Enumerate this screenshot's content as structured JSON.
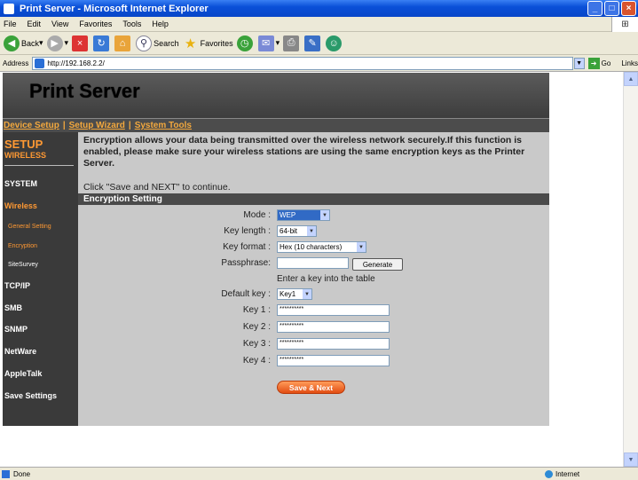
{
  "window": {
    "title": "Print Server - Microsoft Internet Explorer"
  },
  "menu": [
    "File",
    "Edit",
    "View",
    "Favorites",
    "Tools",
    "Help"
  ],
  "toolbar": {
    "back": "Back",
    "search": "Search",
    "favorites": "Favorites"
  },
  "address": {
    "label": "Address",
    "url": "http://192.168.2.2/",
    "go": "Go",
    "links": "Links"
  },
  "page": {
    "banner_title": "Print Server",
    "nav": [
      "Device Setup",
      "Setup Wizard",
      "System Tools"
    ],
    "sidebar": {
      "setup": "SETUP",
      "wireless_sub": "WIRELESS",
      "system": "SYSTEM",
      "wireless": "Wireless",
      "general_setting": "General Setting",
      "encryption": "Encryption",
      "site_survey": "SiteSurvey",
      "tcpip": "TCP/IP",
      "smb": "SMB",
      "snmp": "SNMP",
      "netware": "NetWare",
      "appletalk": "AppleTalk",
      "save_settings": "Save Settings"
    },
    "description": "Encryption allows your data being transmitted over the wireless network securely.If this function is enabled, please make sure your wireless stations are using the same encryption keys as the Printer Server.",
    "instruction": "Click \"Save and NEXT\" to continue.",
    "section_title": "Encryption Setting",
    "form": {
      "mode_label": "Mode :",
      "mode_value": "WEP",
      "keylen_label": "Key length :",
      "keylen_value": "64-bit",
      "keyfmt_label": "Key format :",
      "keyfmt_value": "Hex (10 characters)",
      "pass_label": "Passphrase:",
      "pass_value": "",
      "generate": "Generate",
      "hint": "Enter a key into the table",
      "defkey_label": "Default key :",
      "defkey_value": "Key1",
      "key1_label": "Key 1 :",
      "key1_value": "**********",
      "key2_label": "Key 2 :",
      "key2_value": "**********",
      "key3_label": "Key 3 :",
      "key3_value": "**********",
      "key4_label": "Key 4 :",
      "key4_value": "**********",
      "save": "Save & Next"
    }
  },
  "status": {
    "left": "Done",
    "zone": "Internet"
  }
}
